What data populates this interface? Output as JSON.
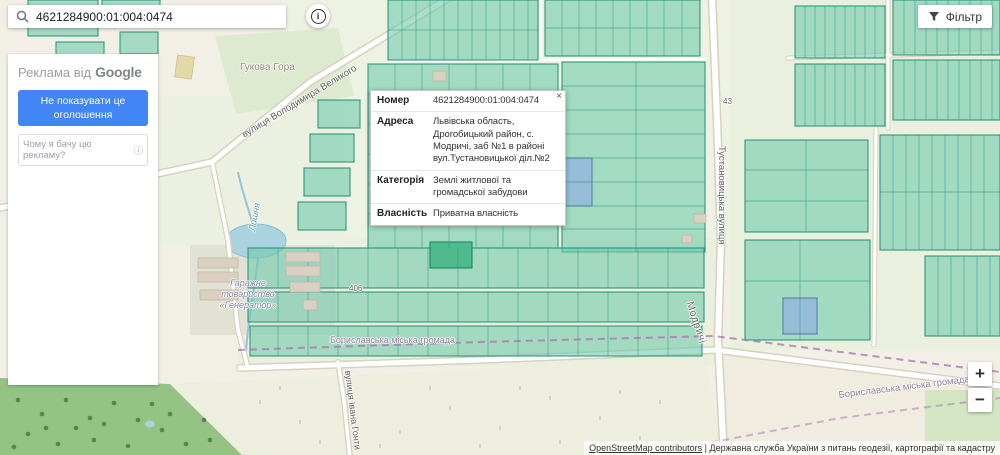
{
  "colors": {
    "accent_blue": "#4285f4",
    "parcel_fill": "#72c9ae",
    "parcel_border": "#1f9077",
    "water": "#aad3df",
    "boundary_purple": "#a774ab"
  },
  "search": {
    "value": "4621284900:01:004:0474"
  },
  "toolbar": {
    "filter_label": "Фільтр",
    "info_glyph": "i"
  },
  "ad_panel": {
    "header": "Реклама від",
    "brand": "Google",
    "dismiss_label": "Не показувати це оголошення",
    "why_label": "Чому я бачу цю рекламу?",
    "why_icon": "ⓘ"
  },
  "popup": {
    "close": "×",
    "rows": [
      {
        "label": "Номер",
        "value": "4621284900:01:004:0474"
      },
      {
        "label": "Адреса",
        "value": "Львівська область, Дрогобицький район, с. Модричі, заб №1 в районі вул.Тустановицької діл.№2"
      },
      {
        "label": "Категорія",
        "value": "Землі житлової та громадської забудови"
      },
      {
        "label": "Власність",
        "value": "Приватна власність"
      }
    ]
  },
  "zoom": {
    "in": "+",
    "out": "−"
  },
  "attribution": {
    "osm": "OpenStreetMap contributors",
    "separator": " | ",
    "gov": "Державна служба України з питань геодезії, картографії та кадастру"
  },
  "map_labels": {
    "hill": "Гукова Гора",
    "street_volodymyra": "вулиця Володимира Великого",
    "street_tustanovytska": "Тустановицька вулиця",
    "street_ivana_honty": "вулиця Івана Гонти",
    "village": "Модричі",
    "garage": "Гаражне\nтовариство\n«Генератор»",
    "hromada_center": "Бориславська міська громада",
    "hromada_right": "Бориславська міська громада",
    "river": "Лишня",
    "parcel_num_406": "406",
    "parcel_num_43": "43"
  }
}
